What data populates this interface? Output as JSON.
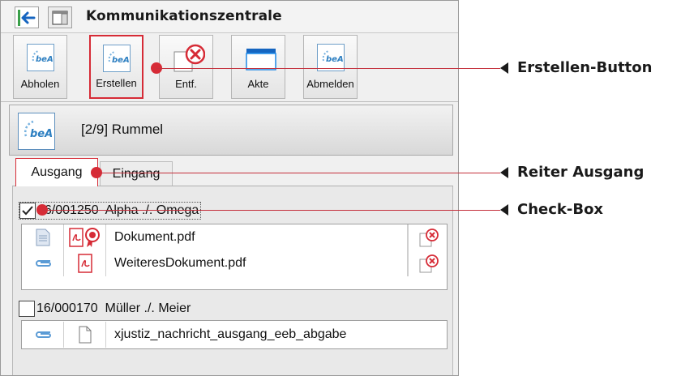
{
  "window": {
    "title": "Kommunikationszentrale"
  },
  "toolbar": {
    "buttons": [
      {
        "label": "Abholen"
      },
      {
        "label": "Erstellen"
      },
      {
        "label": "Entf."
      },
      {
        "label": "Akte"
      },
      {
        "label": "Abmelden"
      }
    ]
  },
  "recipient": {
    "name": "[2/9] Rummel"
  },
  "tabs": [
    {
      "label": "Ausgang",
      "active": true
    },
    {
      "label": "Eingang",
      "active": false
    }
  ],
  "cases": [
    {
      "label": "16/001250  Alpha ./. Omega",
      "checked": true,
      "files": [
        {
          "name": "Dokument.pdf"
        },
        {
          "name": "WeiteresDokument.pdf"
        }
      ]
    },
    {
      "label": "16/000170  Müller ./. Meier",
      "checked": false,
      "files": [
        {
          "name": "xjustiz_nachricht_ausgang_eeb_abgabe"
        }
      ]
    }
  ],
  "annotations": [
    {
      "label": "Erstellen-Button"
    },
    {
      "label": "Reiter Ausgang"
    },
    {
      "label": "Check-Box"
    }
  ],
  "colors": {
    "accent_red": "#d62b36",
    "bea_blue": "#2d7fc1",
    "folder_blue": "#1e88e5"
  },
  "icons": {
    "back": "arrow-left-icon",
    "window": "window-layout-icon",
    "bea": "bea-logo-icon",
    "delete": "delete-document-icon",
    "folder": "folder-icon",
    "pdf": "pdf-icon",
    "seal": "signature-seal-icon",
    "attachment": "paperclip-icon",
    "document": "document-icon",
    "remove": "remove-attachment-icon"
  }
}
